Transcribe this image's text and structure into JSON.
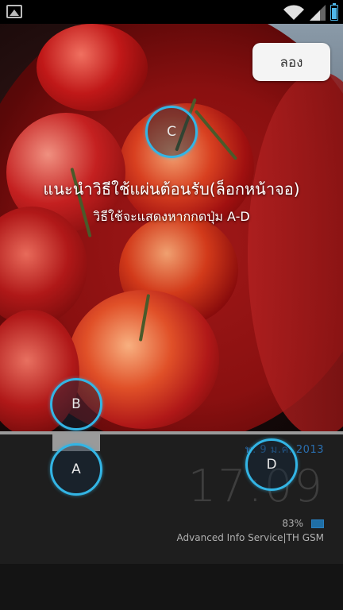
{
  "status_bar": {
    "left_icon": "gallery-icon",
    "wifi_icon": "wifi-icon",
    "signal_icon": "signal-icon",
    "battery_icon": "battery-icon",
    "battery_color": "#4fb8ea"
  },
  "try_button": {
    "label": "ลอง"
  },
  "guide": {
    "title": "แนะนำวิธีใช้แผ่นต้อนรับ(ล็อกหน้าจอ)",
    "subtitle": "วิธีใช้จะแสดงหากกดปุ่ม A-D"
  },
  "hints": [
    {
      "label": "C"
    },
    {
      "label": "B"
    },
    {
      "label": "A"
    },
    {
      "label": "D"
    }
  ],
  "lockscreen": {
    "date": "พ. 9 ม.ค. 2013",
    "time": "17:09",
    "battery_percent": "83%",
    "carrier": "Advanced Info Service|TH GSM",
    "accent_color": "#33b5e5"
  }
}
